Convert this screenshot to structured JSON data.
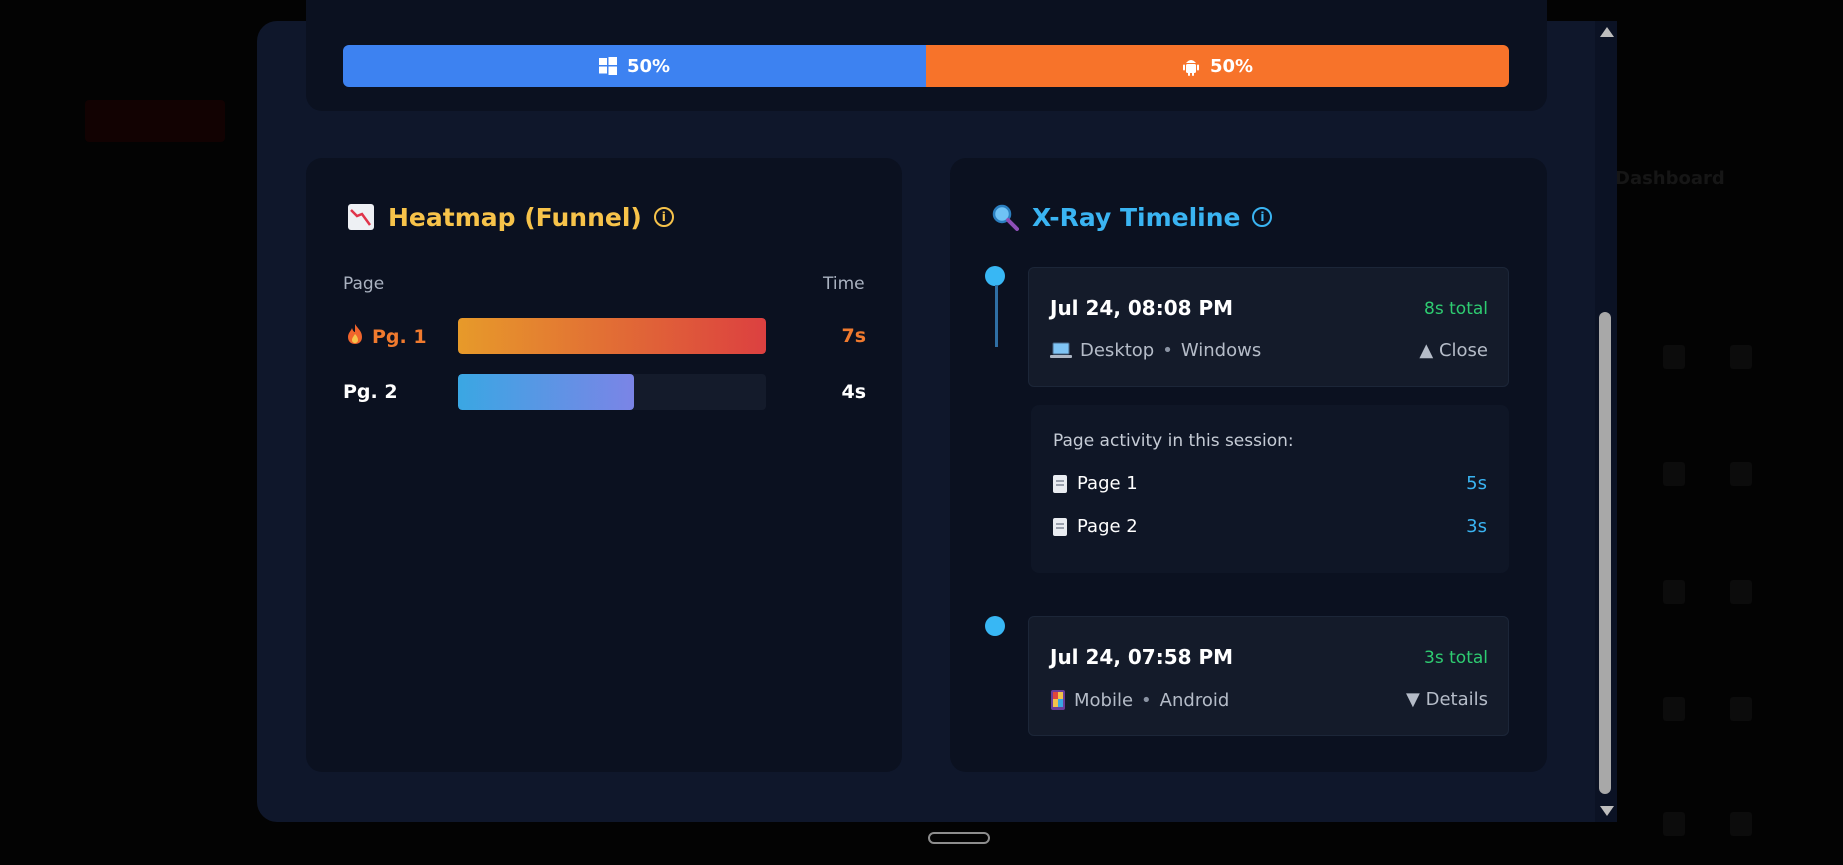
{
  "device_split": {
    "windows": {
      "label": "50%",
      "icon": "windows-icon",
      "color": "#3d82f1"
    },
    "android": {
      "label": "50%",
      "icon": "android-icon",
      "color": "#f7732a"
    }
  },
  "heatmap": {
    "icon": "chart-down-icon",
    "title": "Heatmap (Funnel)",
    "col_page": "Page",
    "col_time": "Time",
    "rows": [
      {
        "label": "Pg. 1",
        "icon": "fire-icon",
        "value": "7s",
        "fill": 1.0,
        "color": "#f07a2e"
      },
      {
        "label": "Pg. 2",
        "value": "4s",
        "fill": 0.57,
        "color": "#ffffff"
      }
    ]
  },
  "xray": {
    "icon": "magnifier-icon",
    "title": "X-Ray Timeline",
    "sessions": [
      {
        "date": "Jul 24, 08:08 PM",
        "total": "8s total",
        "device_icon": "laptop-icon",
        "device": "Desktop",
        "os": "Windows",
        "toggle": "▲ Close",
        "expanded": true,
        "activity_heading": "Page activity in this session:",
        "pages": [
          {
            "name": "Page 1",
            "time": "5s"
          },
          {
            "name": "Page 2",
            "time": "3s"
          }
        ]
      },
      {
        "date": "Jul 24, 07:58 PM",
        "total": "3s total",
        "device_icon": "phone-icon",
        "device": "Mobile",
        "os": "Android",
        "toggle": "▼ Details",
        "expanded": false
      }
    ]
  },
  "background": {
    "title": "Dashboard"
  }
}
